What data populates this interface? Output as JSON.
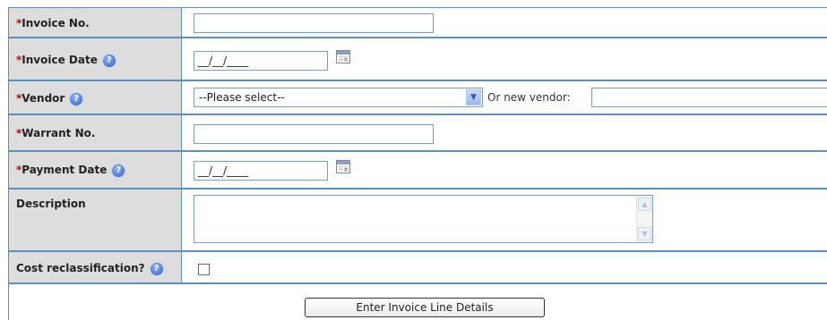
{
  "form": {
    "invoice_no": {
      "required_mark": "*",
      "label": "Invoice No.",
      "value": ""
    },
    "invoice_date": {
      "required_mark": "*",
      "label": "Invoice Date",
      "value": "__/__/____",
      "help_icon": "question-circle-icon",
      "calendar_icon": "calendar-icon"
    },
    "vendor": {
      "required_mark": "*",
      "label": "Vendor",
      "help_icon": "question-circle-icon",
      "selected": "--Please select--",
      "or_new_label": "Or new vendor:",
      "new_vendor_value": ""
    },
    "warrant_no": {
      "required_mark": "*",
      "label": "Warrant No.",
      "value": ""
    },
    "payment_date": {
      "required_mark": "*",
      "label": "Payment Date",
      "value": "__/__/____",
      "help_icon": "question-circle-icon",
      "calendar_icon": "calendar-icon"
    },
    "description": {
      "label": "Description",
      "value": ""
    },
    "cost_reclassification": {
      "label": "Cost reclassification?",
      "help_icon": "question-circle-icon",
      "checked": false
    },
    "submit_label": "Enter Invoice Line Details"
  },
  "colors": {
    "border": "#5d8fbd",
    "label_bg": "#dddddd",
    "required": "#cc0000",
    "help_icon": "#2e5fd0"
  }
}
